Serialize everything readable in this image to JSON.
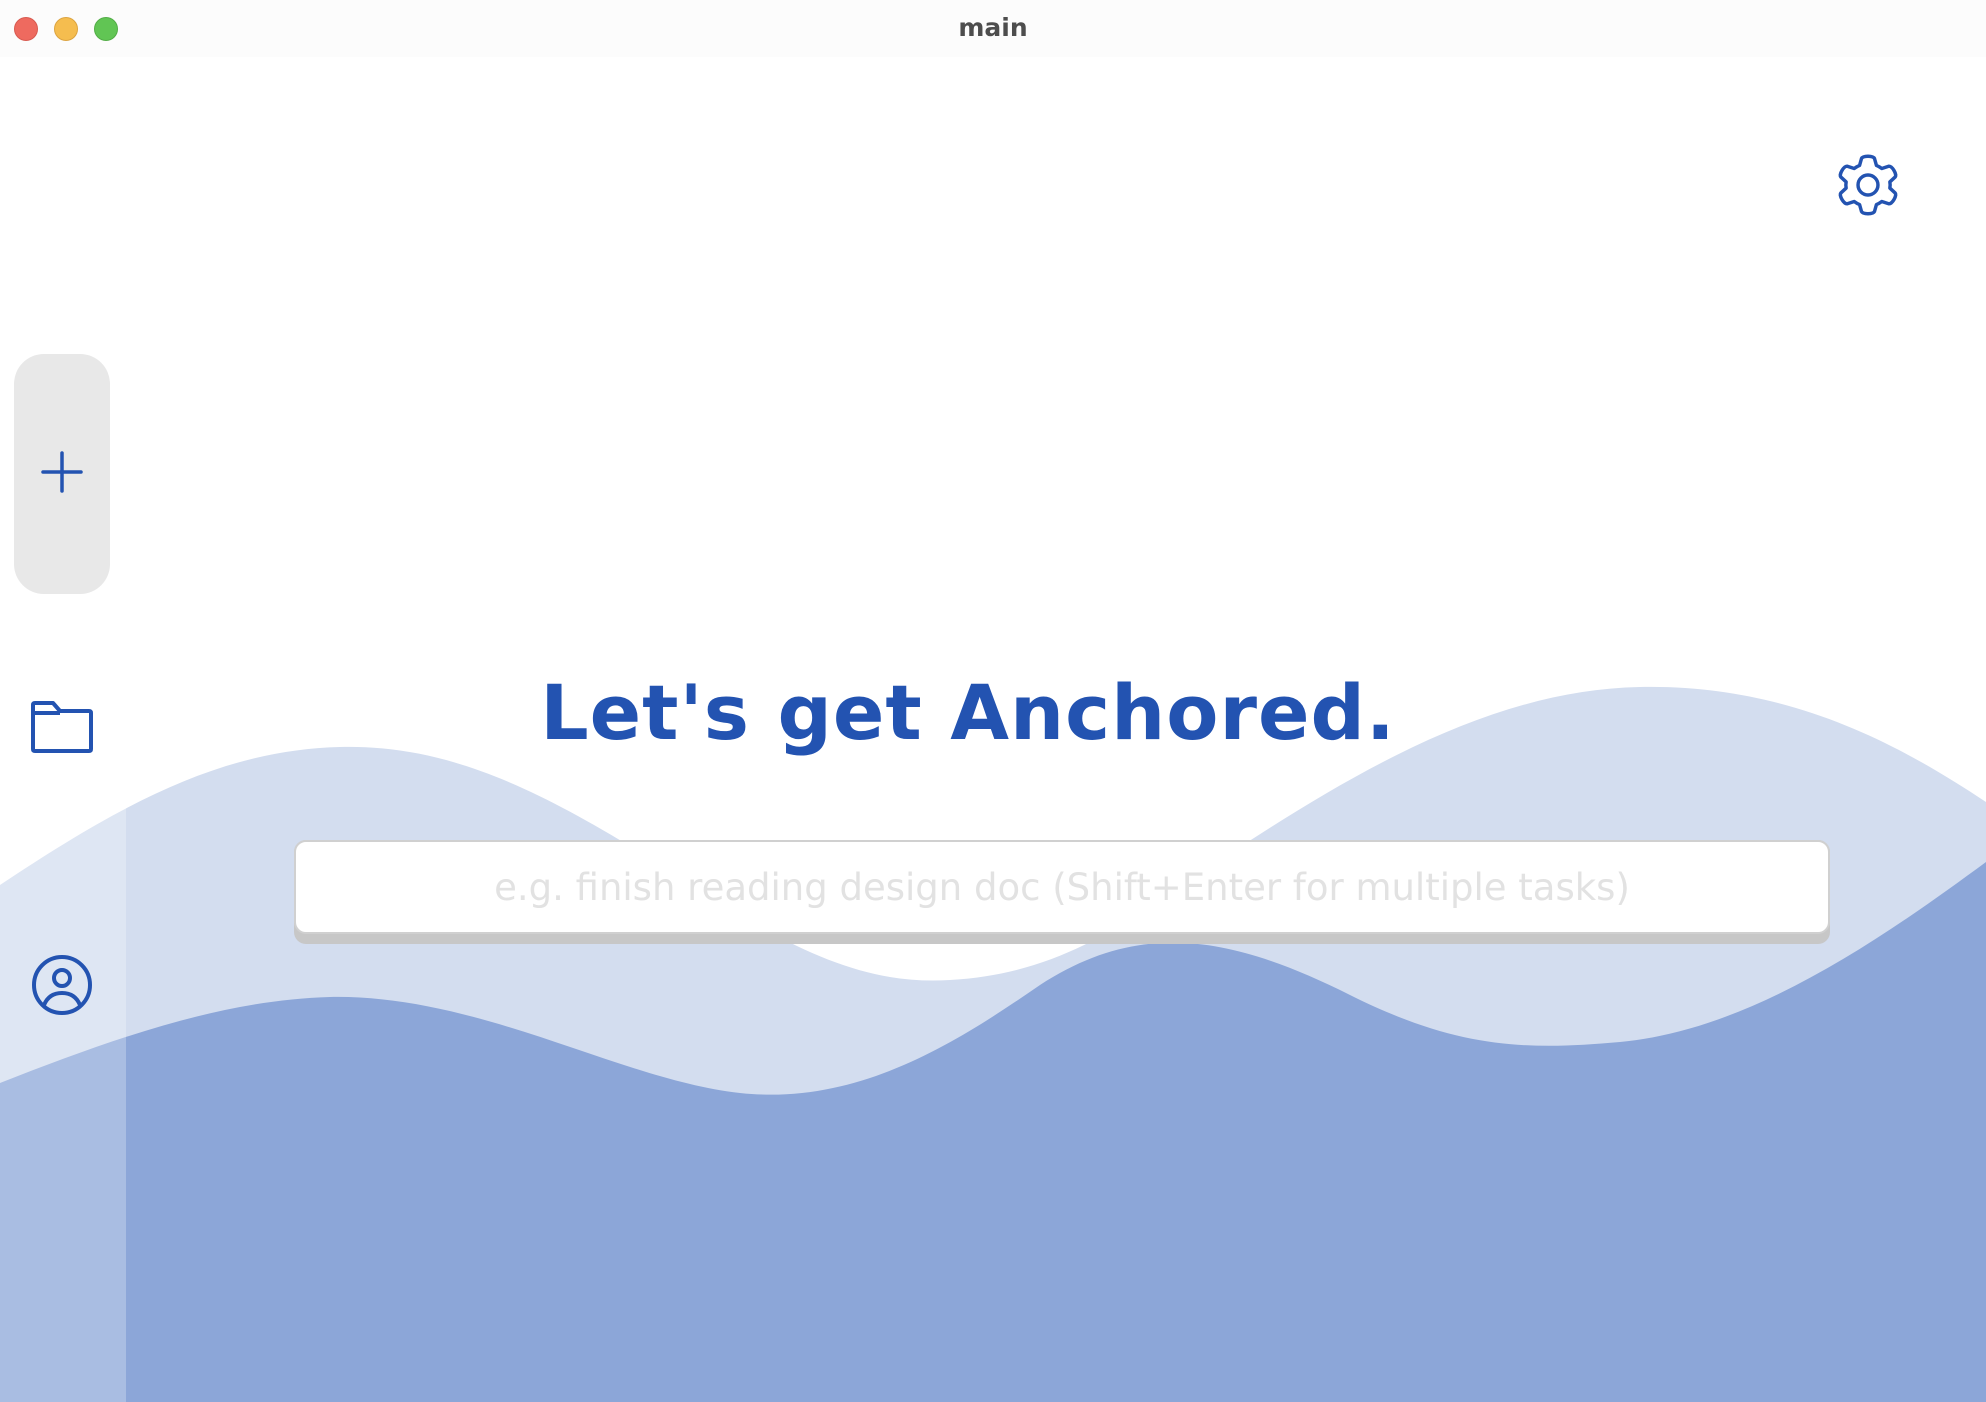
{
  "window": {
    "title": "main"
  },
  "sidebar": {
    "items": [
      {
        "name": "new-task",
        "icon": "plus-icon"
      },
      {
        "name": "projects",
        "icon": "folder-icon"
      },
      {
        "name": "account",
        "icon": "user-circle-icon"
      }
    ]
  },
  "header": {
    "settings_icon": "gear-icon"
  },
  "main": {
    "headline": "Let's get Anchored.",
    "task_input": {
      "value": "",
      "placeholder": "e.g. finish reading design doc (Shift+Enter for multiple tasks)"
    }
  },
  "colors": {
    "accent": "#2353b1",
    "wave_light": "#d3ddef",
    "wave_dark": "#8ca6d8",
    "button_bg": "#e8e8e8"
  }
}
